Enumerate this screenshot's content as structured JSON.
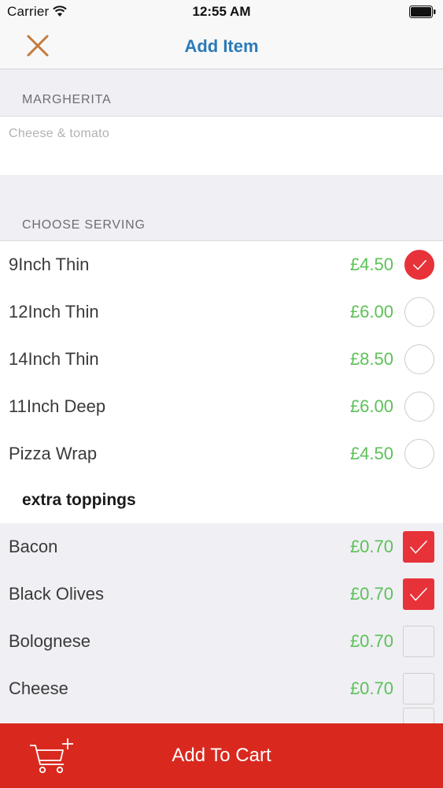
{
  "status_bar": {
    "carrier": "Carrier",
    "time": "12:55 AM",
    "wifi_icon": "wifi-icon",
    "battery_icon": "battery-icon"
  },
  "nav": {
    "title": "Add Item",
    "close_icon": "close-icon",
    "title_color": "#2a7ab8",
    "close_color": "#c47a3c"
  },
  "item": {
    "name": "MARGHERITA",
    "description": "Cheese & tomato"
  },
  "serving": {
    "label": "CHOOSE SERVING",
    "options": [
      {
        "name": "9Inch Thin",
        "price": "£4.50",
        "selected": true
      },
      {
        "name": "12Inch Thin",
        "price": "£6.00",
        "selected": false
      },
      {
        "name": "14Inch Thin",
        "price": "£8.50",
        "selected": false
      },
      {
        "name": "11Inch Deep",
        "price": "£6.00",
        "selected": false
      },
      {
        "name": "Pizza Wrap",
        "price": "£4.50",
        "selected": false
      }
    ]
  },
  "toppings": {
    "title": "extra toppings",
    "items": [
      {
        "name": "Bacon",
        "price": "£0.70",
        "checked": true
      },
      {
        "name": "Black Olives",
        "price": "£0.70",
        "checked": true
      },
      {
        "name": "Bolognese",
        "price": "£0.70",
        "checked": false
      },
      {
        "name": "Cheese",
        "price": "£0.70",
        "checked": false
      }
    ]
  },
  "cart": {
    "label": "Add To Cart",
    "icon": "add-to-cart-icon"
  },
  "colors": {
    "accent_red": "#e8323a",
    "price_green": "#5cc157",
    "cart_bar": "#d9291f"
  }
}
